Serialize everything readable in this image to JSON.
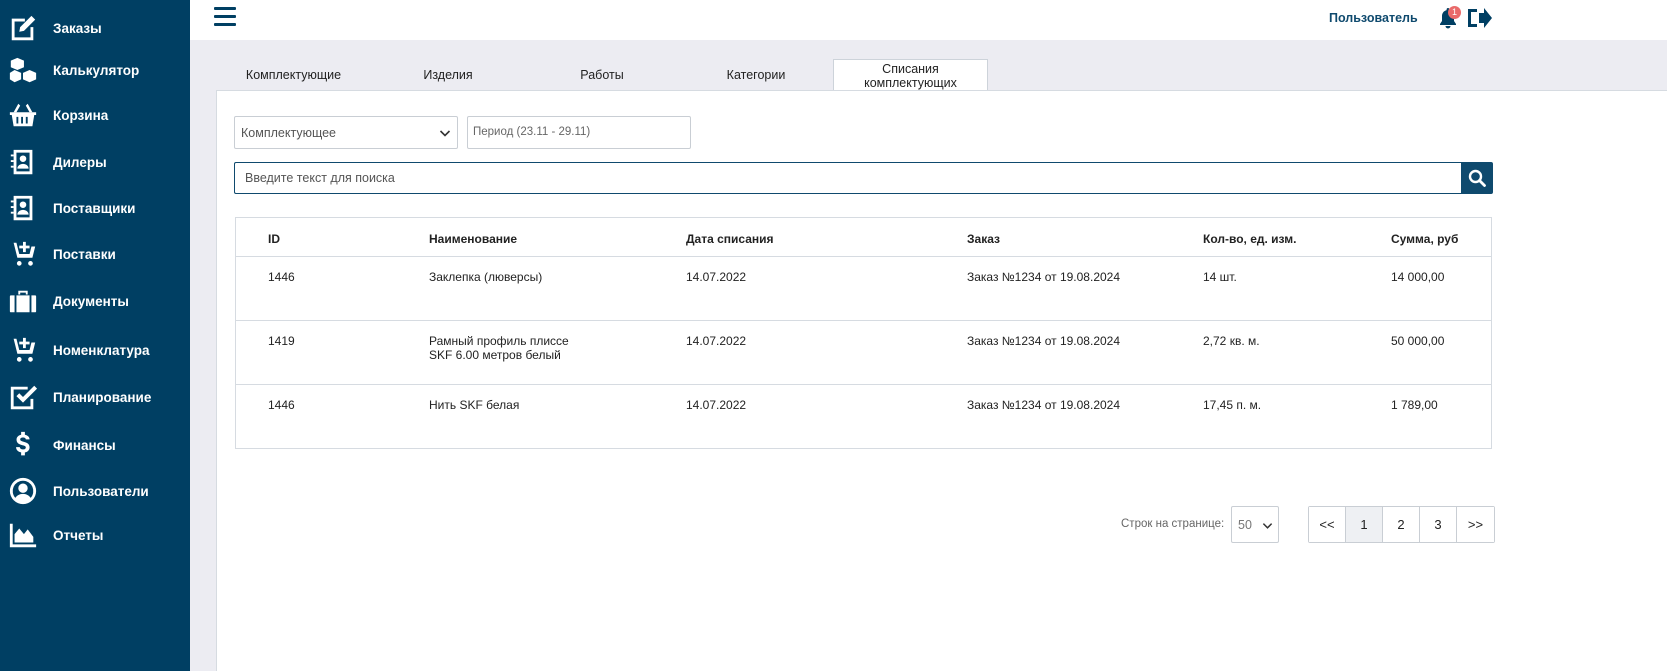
{
  "sidebar": {
    "items": [
      {
        "label": "Заказы",
        "icon": "pencil-square-icon"
      },
      {
        "label": "Калькулятор",
        "icon": "cubes-icon"
      },
      {
        "label": "Корзина",
        "icon": "basket-icon"
      },
      {
        "label": "Дилеры",
        "icon": "contact-book-icon"
      },
      {
        "label": "Поставщики",
        "icon": "contact-book-icon"
      },
      {
        "label": "Поставки",
        "icon": "cart-plus-icon"
      },
      {
        "label": "Документы",
        "icon": "suitcase-icon"
      },
      {
        "label": "Номенклатура",
        "icon": "cart-plus-icon"
      },
      {
        "label": "Планирование",
        "icon": "check-square-icon"
      },
      {
        "label": "Финансы",
        "icon": "dollar-icon"
      },
      {
        "label": "Пользователи",
        "icon": "user-circle-icon"
      },
      {
        "label": "Отчеты",
        "icon": "area-chart-icon"
      }
    ]
  },
  "header": {
    "user_label": "Пользователь",
    "notifications_count": "1"
  },
  "tabs": [
    {
      "label": "Комплектующие",
      "active": false
    },
    {
      "label": "Изделия",
      "active": false
    },
    {
      "label": "Работы",
      "active": false
    },
    {
      "label": "Категории",
      "active": false
    },
    {
      "label": "Списания\nкомплектующих",
      "active": true
    }
  ],
  "filters": {
    "component_select": "Комплектующее",
    "period_placeholder": "Период (23.11 - 29.11)"
  },
  "search": {
    "placeholder": "Введите текст для поиска"
  },
  "table": {
    "columns": [
      "ID",
      "Наименование",
      "Дата списания",
      "Заказ",
      "Кол-во, ед. изм.",
      "Сумма, руб"
    ],
    "rows": [
      [
        "1446",
        "Заклепка (люверсы)",
        "14.07.2022",
        "Заказ №1234 от 19.08.2024",
        "14 шт.",
        "14 000,00"
      ],
      [
        "1419",
        "Рамный профиль плиссе\nSKF 6.00 метров белый",
        "14.07.2022",
        "Заказ №1234 от 19.08.2024",
        "2,72 кв. м.",
        "50 000,00"
      ],
      [
        "1446",
        "Нить SKF белая",
        "14.07.2022",
        "Заказ №1234 от 19.08.2024",
        "17,45 п. м.",
        "1 789,00"
      ]
    ]
  },
  "pagination": {
    "rows_label": "Строк на странице:",
    "rows_value": "50",
    "first": "<<",
    "pages": [
      "1",
      "2",
      "3"
    ],
    "active_page": "1",
    "last": ">>"
  },
  "colors": {
    "sidebar_bg": "#003f63",
    "accent": "#0f4a6e",
    "badge": "#e96a6a"
  }
}
